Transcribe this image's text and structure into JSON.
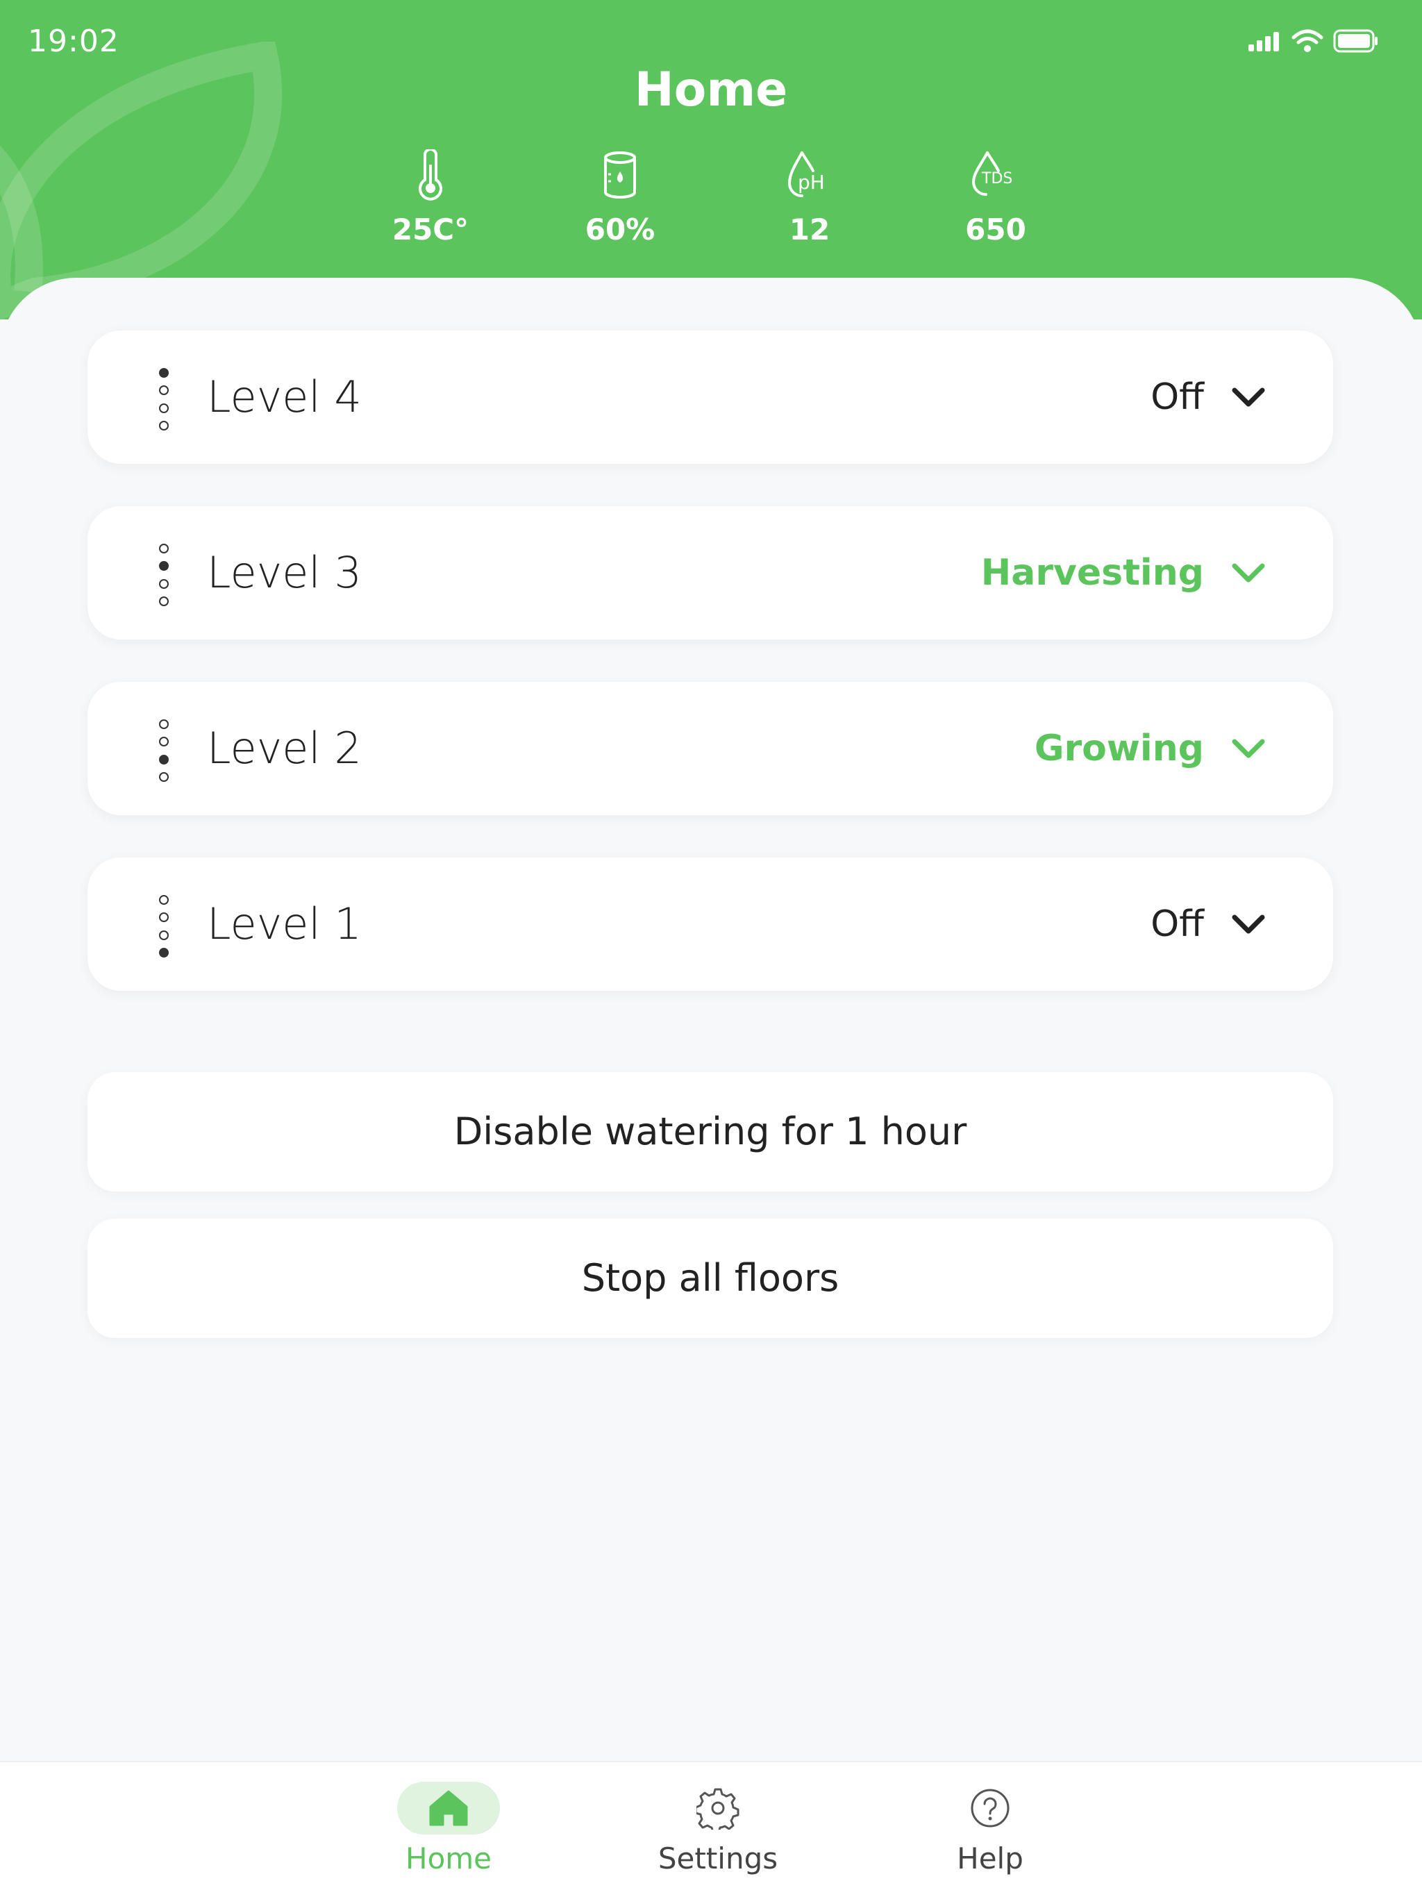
{
  "status_bar": {
    "time": "19:02",
    "icons": [
      "signal-icon",
      "wifi-icon",
      "battery-icon"
    ]
  },
  "header": {
    "title": "Home",
    "metrics": [
      {
        "icon": "thermometer-icon",
        "value": "25C°"
      },
      {
        "icon": "water-tank-icon",
        "value": "60%"
      },
      {
        "icon": "ph-drop-icon",
        "label": "pH",
        "value": "12"
      },
      {
        "icon": "tds-drop-icon",
        "label": "TDS",
        "value": "650"
      }
    ]
  },
  "levels": [
    {
      "name": "Level 4",
      "status": "Off",
      "active": false,
      "position": 1
    },
    {
      "name": "Level 3",
      "status": "Harvesting",
      "active": true,
      "position": 2
    },
    {
      "name": "Level 2",
      "status": "Growing",
      "active": true,
      "position": 3
    },
    {
      "name": "Level 1",
      "status": "Off",
      "active": false,
      "position": 4
    }
  ],
  "actions": {
    "disable_watering": "Disable watering for 1 hour",
    "stop_all": "Stop all floors"
  },
  "tabbar": {
    "tabs": [
      {
        "label": "Home",
        "icon": "home-icon",
        "active": true
      },
      {
        "label": "Settings",
        "icon": "gear-icon",
        "active": false
      },
      {
        "label": "Help",
        "icon": "help-icon",
        "active": false
      }
    ]
  },
  "colors": {
    "brand_green": "#5cc45c",
    "text_dark": "#222222",
    "background": "#f7f8fa"
  }
}
